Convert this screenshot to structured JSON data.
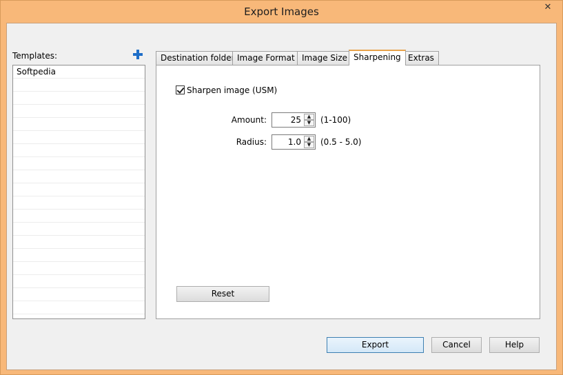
{
  "window": {
    "title": "Export Images",
    "close_glyph": "✕"
  },
  "templates": {
    "label": "Templates:",
    "add_icon": "plus-icon",
    "items": [
      "Softpedia"
    ]
  },
  "tabs": [
    {
      "label": "Destination folder",
      "active": false
    },
    {
      "label": "Image Format",
      "active": false
    },
    {
      "label": "Image Size",
      "active": false
    },
    {
      "label": "Sharpening",
      "active": true
    },
    {
      "label": "Extras",
      "active": false
    }
  ],
  "sharpening": {
    "checkbox_label": "Sharpen image (USM)",
    "checked": true,
    "amount": {
      "label": "Amount:",
      "value": "25",
      "range": "(1-100)"
    },
    "radius": {
      "label": "Radius:",
      "value": "1.0",
      "range": "(0.5 - 5.0)"
    },
    "reset_label": "Reset"
  },
  "footer": {
    "export_label": "Export",
    "cancel_label": "Cancel",
    "help_label": "Help"
  },
  "colors": {
    "frame": "#f8b879",
    "active_tab_accent": "#e8a24a",
    "add_icon": "#1e6ec8"
  }
}
